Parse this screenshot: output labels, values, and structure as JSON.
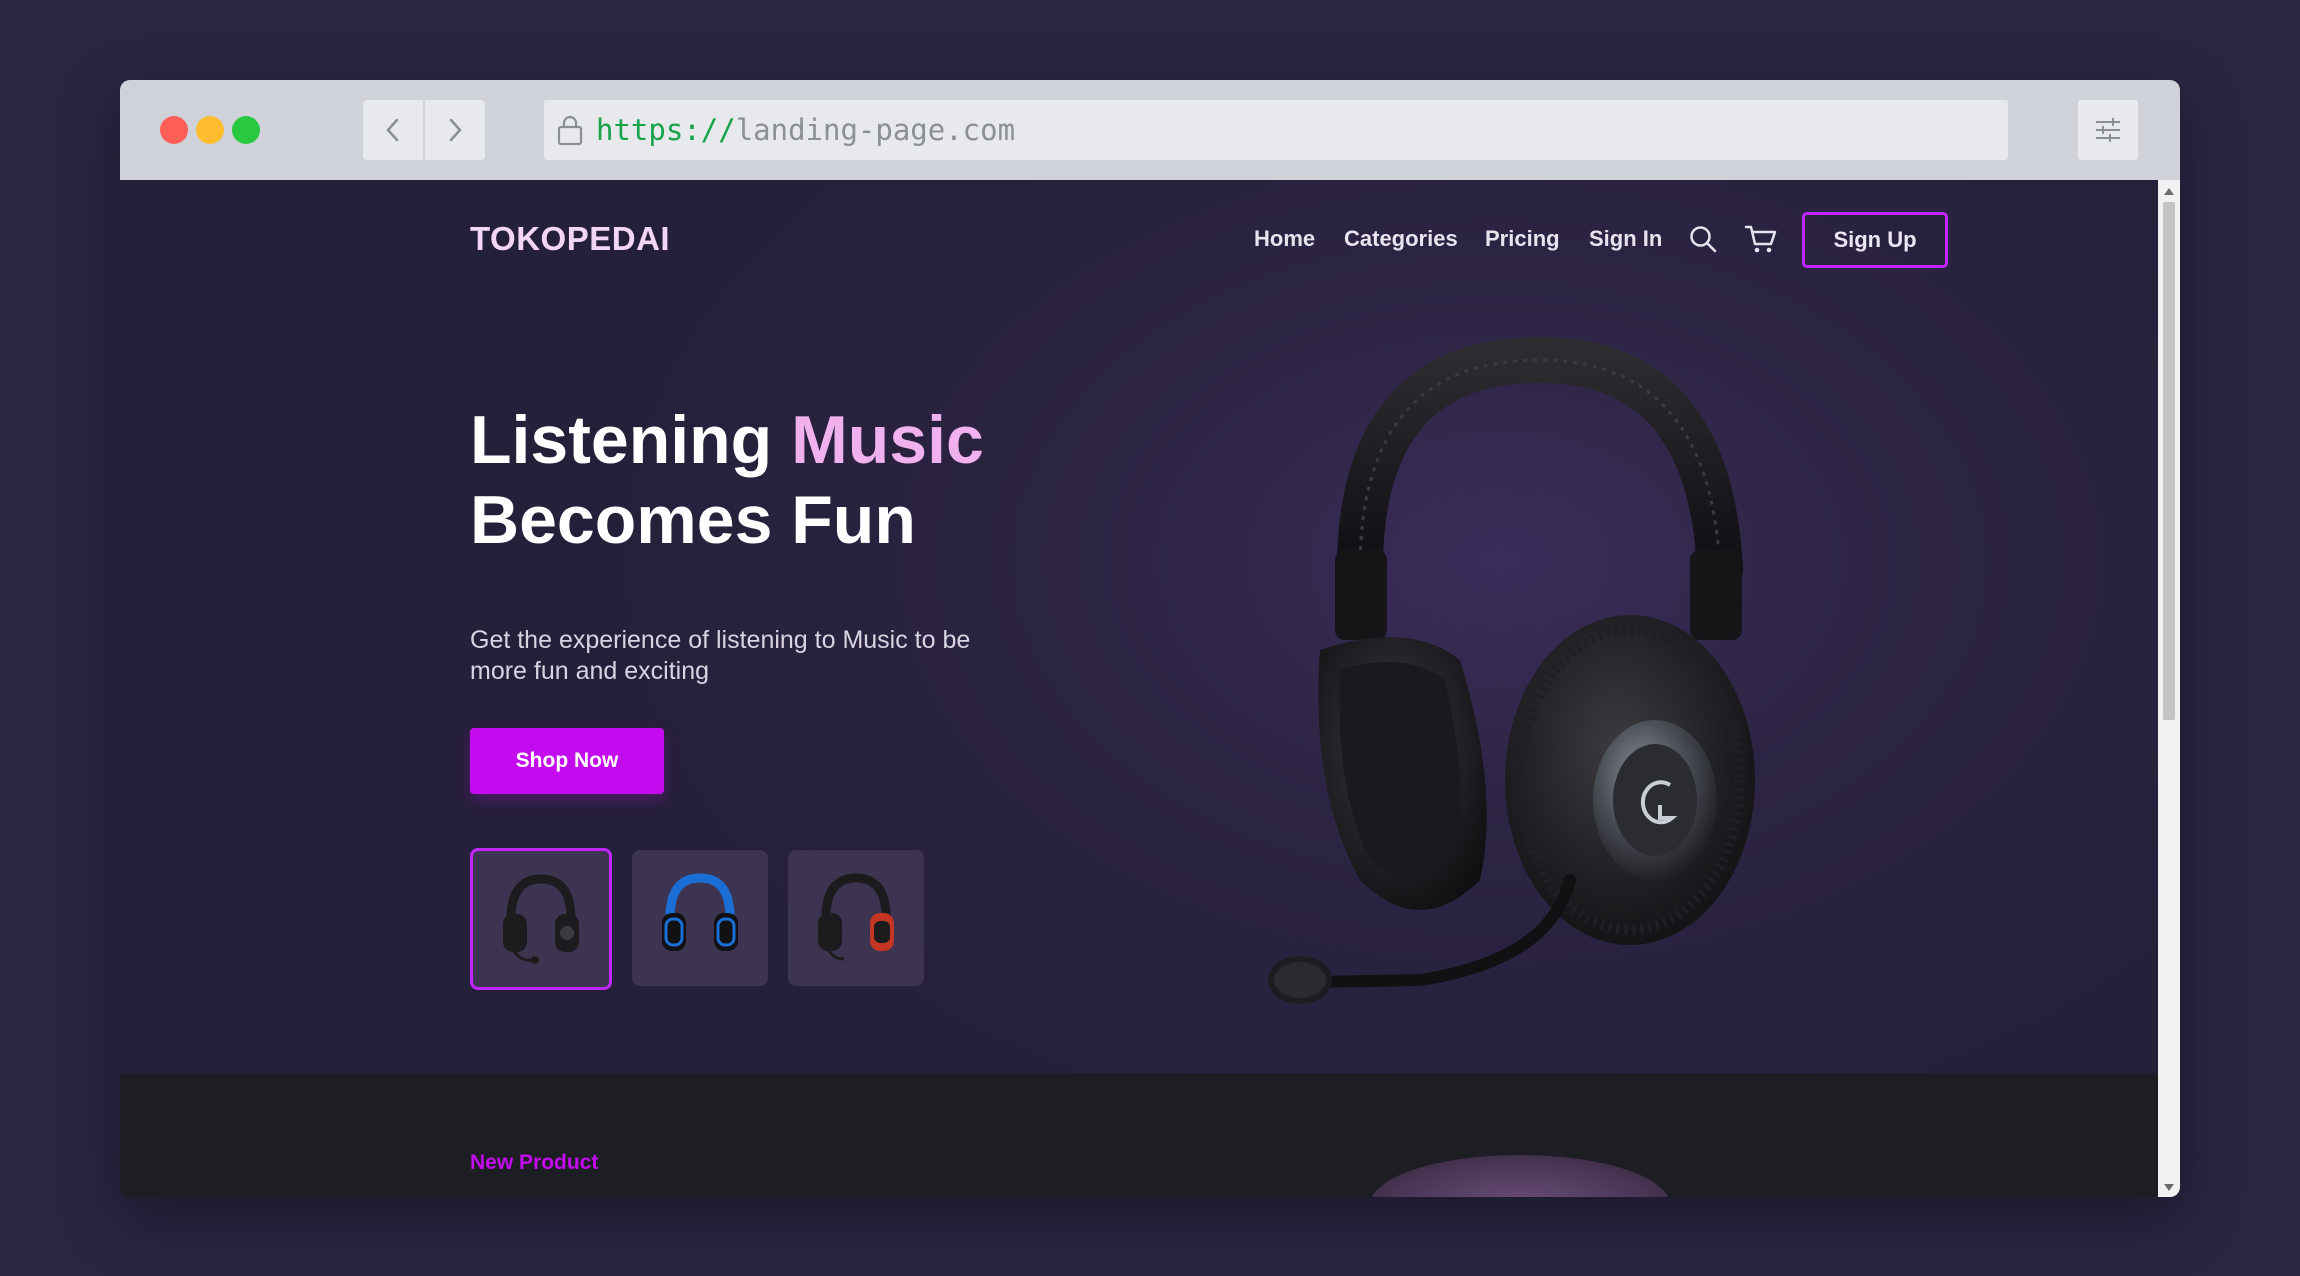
{
  "browser": {
    "url_scheme": "https://",
    "url_host": "landing-page.com"
  },
  "site": {
    "logo": "TOKOPEDAI",
    "nav": {
      "home": "Home",
      "categories": "Categories",
      "pricing": "Pricing",
      "sign_in": "Sign In",
      "sign_up": "Sign Up"
    }
  },
  "hero": {
    "title_part1": "Listening ",
    "title_accent": "Music",
    "title_line2": "Becomes Fun",
    "subtitle": "Get the experience of listening to Music to be more fun and exciting",
    "cta": "Shop Now"
  },
  "thumbnails": [
    {
      "name": "black-headset",
      "color": "#1c1c1f",
      "accent": "#3a3a40"
    },
    {
      "name": "blue-headset",
      "color": "#1a6fd6",
      "accent": "#111114"
    },
    {
      "name": "red-headset",
      "color": "#c53524",
      "accent": "#1c1c1f"
    }
  ],
  "section": {
    "label": "New Product"
  },
  "colors": {
    "accent": "#c40bf0",
    "background": "#27223a"
  }
}
